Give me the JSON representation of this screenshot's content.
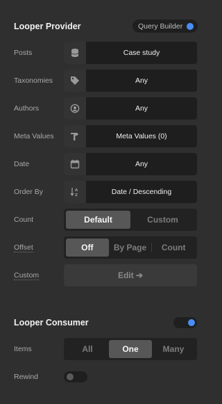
{
  "provider": {
    "title": "Looper Provider",
    "query_builder_label": "Query Builder",
    "query_builder_enabled": true,
    "rows": {
      "posts": {
        "label": "Posts",
        "value": "Case study",
        "icon": "database-icon"
      },
      "taxonomies": {
        "label": "Taxonomies",
        "value": "Any",
        "icon": "tag-icon"
      },
      "authors": {
        "label": "Authors",
        "value": "Any",
        "icon": "user-circle-icon"
      },
      "meta": {
        "label": "Meta Values",
        "value": "Meta Values (0)",
        "icon": "hammer-icon"
      },
      "date": {
        "label": "Date",
        "value": "Any",
        "icon": "calendar-icon"
      },
      "order": {
        "label": "Order By",
        "value": "Date / Descending",
        "icon": "sort-az-icon"
      }
    },
    "count": {
      "label": "Count",
      "options": [
        "Default",
        "Custom"
      ],
      "selected": "Default"
    },
    "offset": {
      "label": "Offset",
      "options": [
        "Off",
        "By Page",
        "Count"
      ],
      "selected": "Off"
    },
    "custom": {
      "label": "Custom",
      "button": "Edit ➔"
    }
  },
  "consumer": {
    "title": "Looper Consumer",
    "enabled": true,
    "items": {
      "label": "Items",
      "options": [
        "All",
        "One",
        "Many"
      ],
      "selected": "One"
    },
    "rewind": {
      "label": "Rewind",
      "enabled": false
    }
  },
  "colors": {
    "accent": "#4b8ef2",
    "background": "#2f2f2f"
  }
}
